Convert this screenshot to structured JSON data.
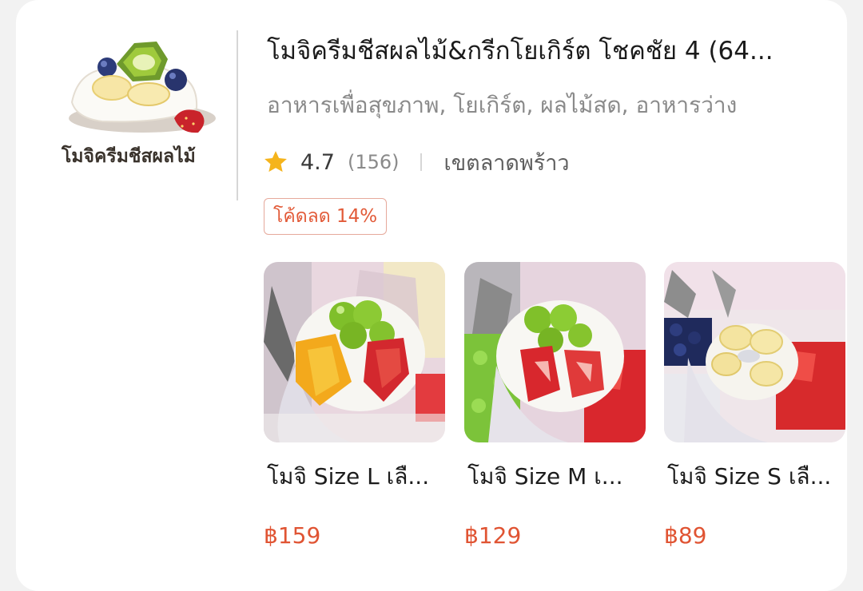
{
  "shop": {
    "logo_text": "โมจิครีมชีสผลไม้",
    "name": "โมจิครีมชีสผลไม้&กรีกโยเกิร์ต โชคชัย 4 (64...",
    "categories": "อาหารเพื่อสุขภาพ, โยเกิร์ต, ผลไม้สด, อาหารว่าง",
    "rating": "4.7",
    "reviews": "(156)",
    "area": "เขตลาดพร้าว",
    "coupon": "โค้ดลด 14%"
  },
  "products": [
    {
      "name": "โมจิ Size L เลื...",
      "price": "฿159"
    },
    {
      "name": "โมจิ Size M เ...",
      "price": "฿129"
    },
    {
      "name": "โมจิ Size S เลื...",
      "price": "฿89"
    }
  ],
  "colors": {
    "accent": "#e05433",
    "star": "#f5b41c",
    "coupon_border": "#e6a99b"
  },
  "icons": [
    "star-icon"
  ]
}
